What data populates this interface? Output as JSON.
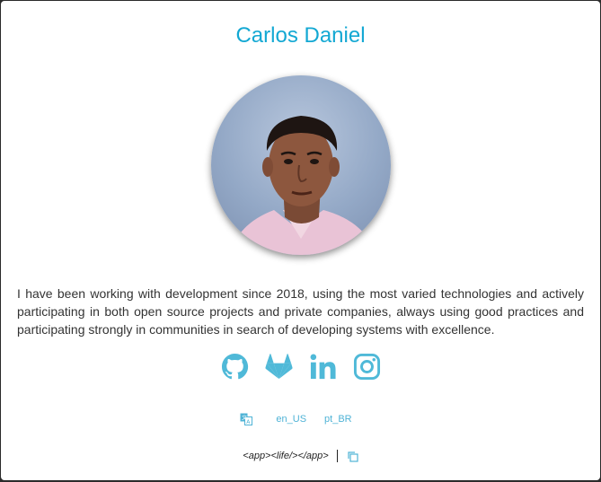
{
  "profile": {
    "name": "Carlos Daniel",
    "bio": "I have been working with development since 2018, using the most varied technologies and actively participating in both open source projects and private companies, always using good practices and participating strongly in communities in search of developing systems with excellence."
  },
  "social": {
    "icons": [
      "github-icon",
      "gitlab-icon",
      "linkedin-icon",
      "instagram-icon"
    ],
    "color": "#4fb9d8"
  },
  "language": {
    "icon": "translate-icon",
    "options": [
      "en_US",
      "pt_BR"
    ]
  },
  "footer": {
    "tag": "<app><life/></app>",
    "copy_icon": "copy-icon"
  },
  "colors": {
    "accent": "#13a8d3",
    "link": "#4fb3d6"
  }
}
